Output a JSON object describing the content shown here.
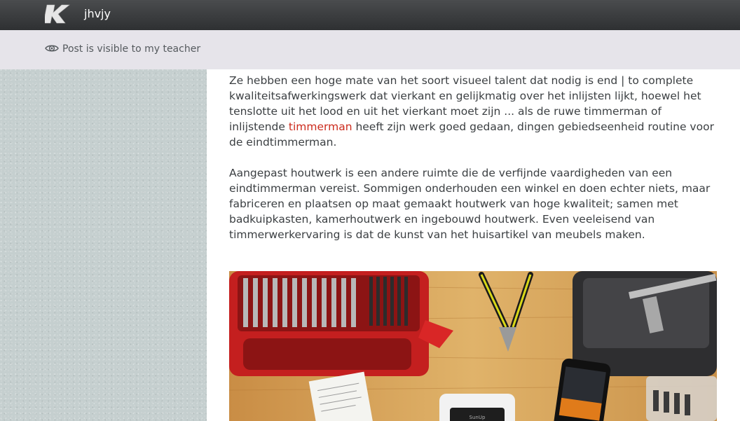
{
  "header": {
    "logo_letter": "K",
    "site_name": "jhvjy"
  },
  "visibility": {
    "icon": "eye-icon",
    "text": "Post is visible to my teacher"
  },
  "post": {
    "paragraph1_before_link": "Ze hebben een hoge mate van het soort visueel talent dat nodig is end | to complete kwaliteitsafwerkingswerk dat vierkant en gelijkmatig over het inlijsten lijkt, hoewel het tenslotte uit het lood en uit het vierkant moet zijn ... als de ruwe timmerman of inlijstende ",
    "paragraph1_link": "timmerman",
    "paragraph1_after_link": " heeft zijn werk goed gedaan, dingen gebiedseenheid routine voor de eindtimmerman.",
    "paragraph2": "Aangepast houtwerk is een andere ruimte die de verfijnde vaardigheden van een eindtimmerman vereist. Sommigen onderhouden een winkel en doen echter niets, maar fabriceren en plaatsen op maat gemaakt houtwerk van hoge kwaliteit; samen met badkuipkasten, kamerhoutwerk en ingebouwd houtwerk. Even veeleisend van timmerwerkervaring is dat de kunst van het huisartikel van meubels maken.",
    "image_phone_text": "SunUp"
  },
  "colors": {
    "link": "#cc2b1d",
    "topbar": "#3a3c3e",
    "visibility_bar": "#e6e4ea",
    "background": "#c5cfcf"
  }
}
